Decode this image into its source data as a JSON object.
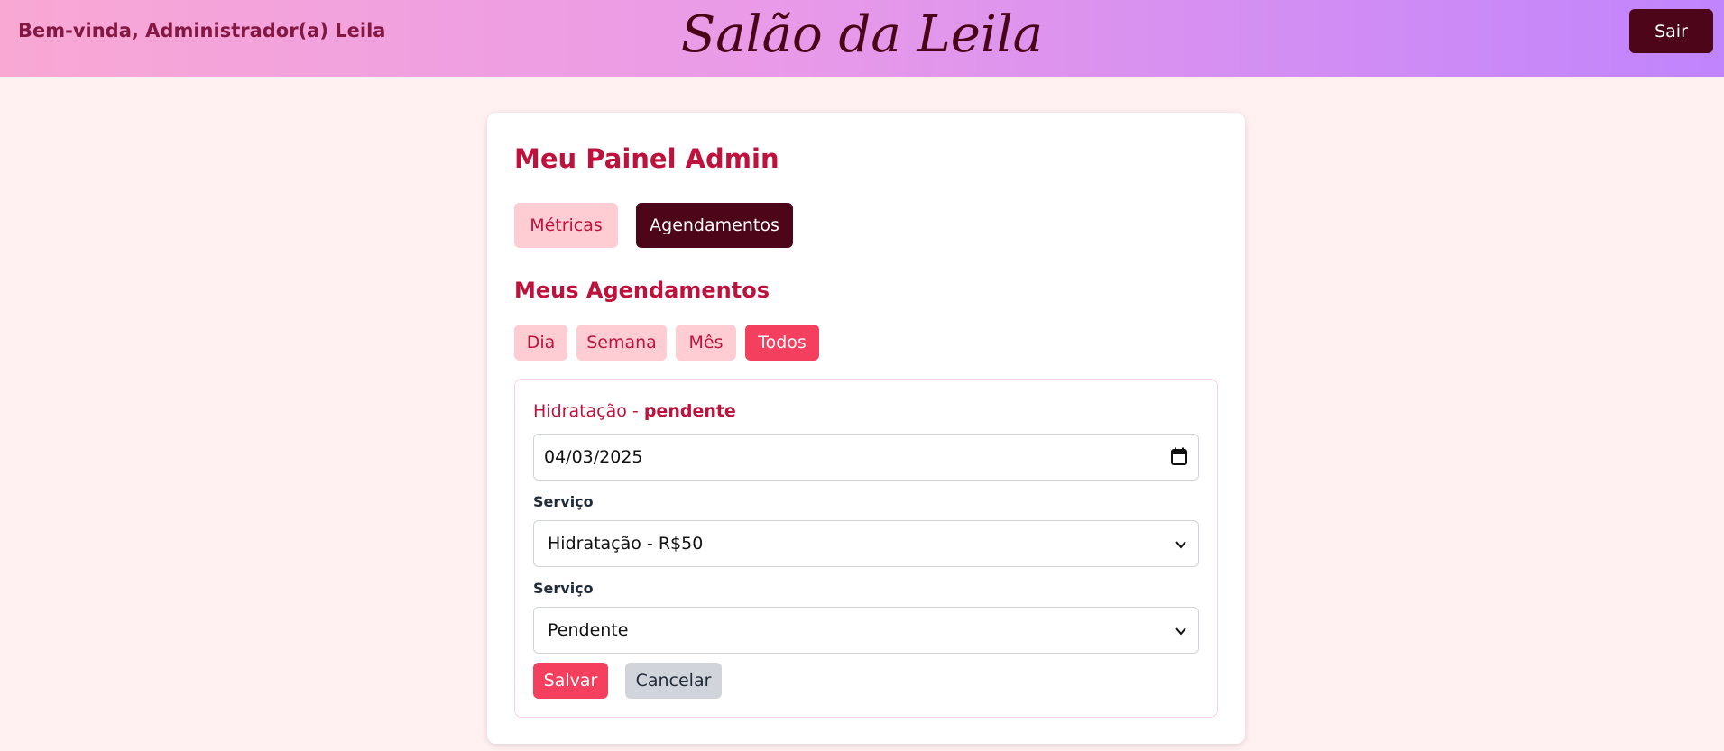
{
  "header": {
    "welcome": "Bem-vinda, Administrador(a) Leila",
    "brand": "Salão da Leila",
    "logout_label": "Sair"
  },
  "panel": {
    "title": "Meu Painel Admin",
    "tabs": [
      {
        "label": "Métricas",
        "active": false
      },
      {
        "label": "Agendamentos",
        "active": true
      }
    ]
  },
  "appointments": {
    "title": "Meus Agendamentos",
    "filters": [
      {
        "label": "Dia",
        "active": false
      },
      {
        "label": "Semana",
        "active": false
      },
      {
        "label": "Mês",
        "active": false
      },
      {
        "label": "Todos",
        "active": true
      }
    ],
    "item": {
      "service_name": "Hidratação",
      "separator": " - ",
      "status": "pendente",
      "date_value": "04/03/2025",
      "service_label": "Serviço",
      "service_value": "Hidratação - R$50",
      "status_label": "Serviço",
      "status_value": "Pendente",
      "save_label": "Salvar",
      "cancel_label": "Cancelar"
    }
  },
  "colors": {
    "accent": "#f43f5e",
    "dark": "#4c0519",
    "title": "#be123c"
  }
}
